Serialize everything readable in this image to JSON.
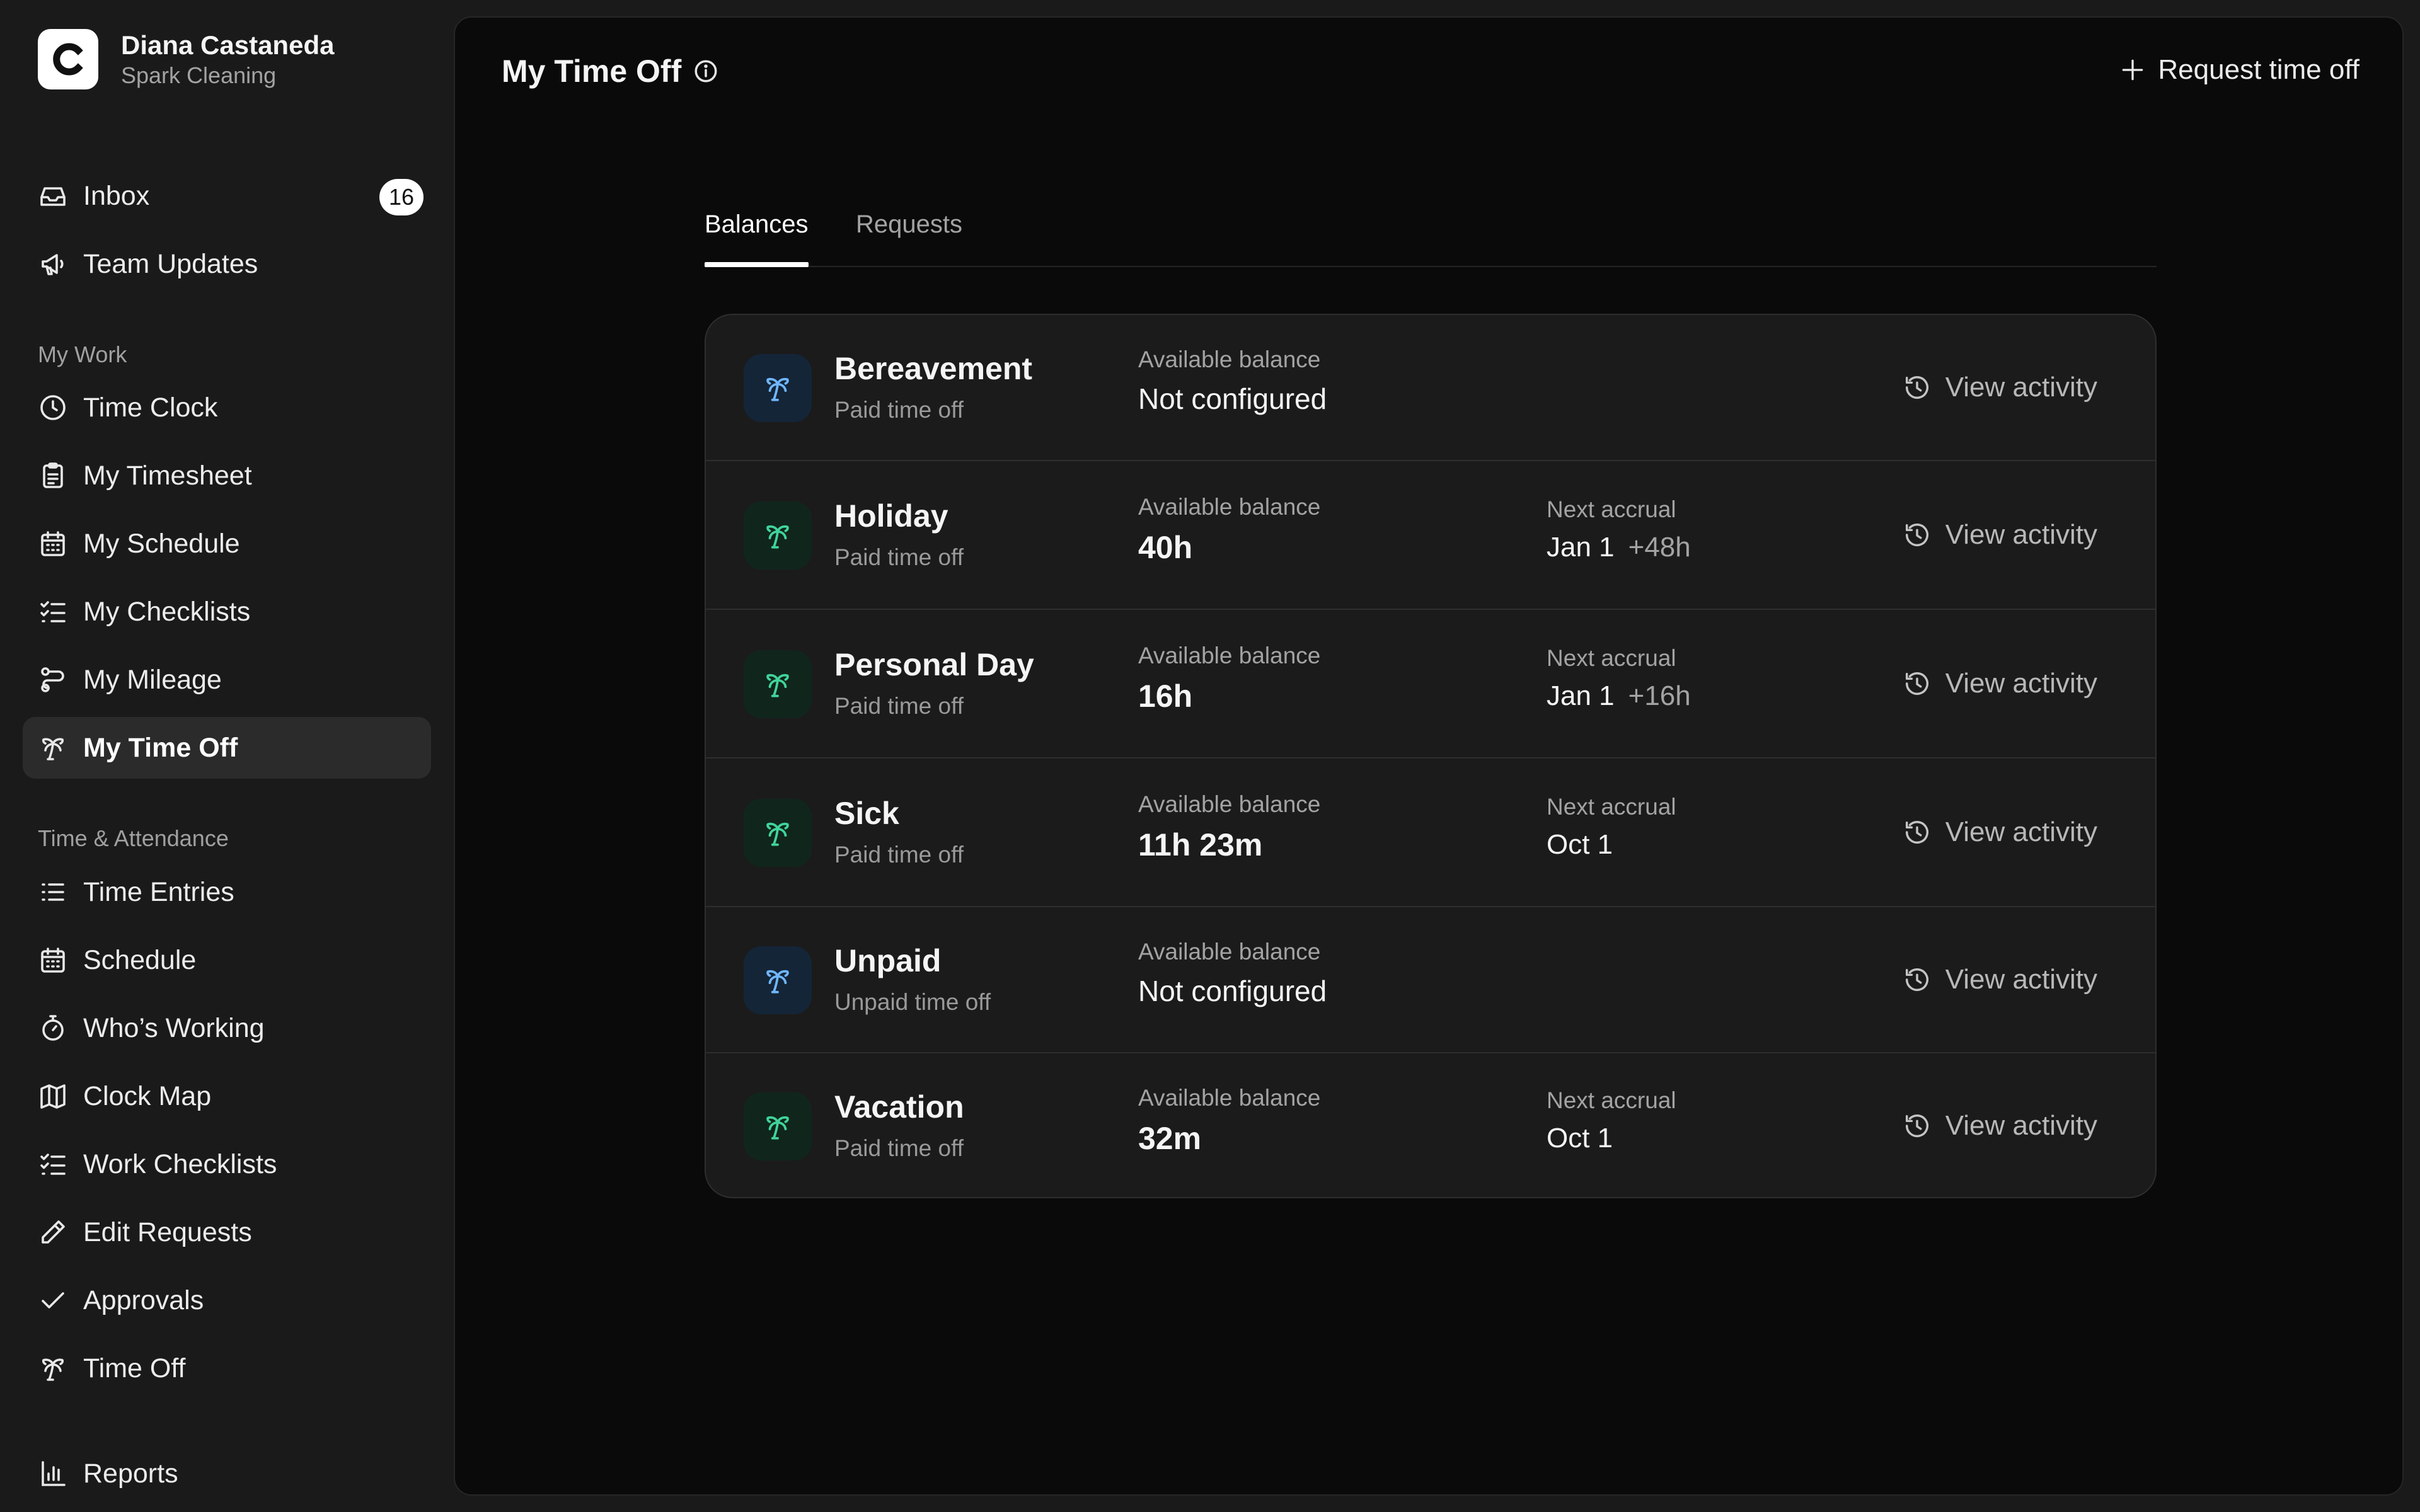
{
  "account": {
    "name": "Diana Castaneda",
    "org": "Spark Cleaning",
    "logo_letter": "C"
  },
  "nav": {
    "top": [
      {
        "id": "inbox",
        "label": "Inbox",
        "icon": "inbox-icon",
        "badge": "16"
      },
      {
        "id": "team-updates",
        "label": "Team Updates",
        "icon": "megaphone-icon"
      }
    ],
    "my_work_label": "My Work",
    "my_work": [
      {
        "id": "time-clock",
        "label": "Time Clock",
        "icon": "clock-icon"
      },
      {
        "id": "my-timesheet",
        "label": "My Timesheet",
        "icon": "clipboard-icon"
      },
      {
        "id": "my-schedule",
        "label": "My Schedule",
        "icon": "calendar-icon"
      },
      {
        "id": "my-checklists",
        "label": "My Checklists",
        "icon": "checklist-icon"
      },
      {
        "id": "my-mileage",
        "label": "My Mileage",
        "icon": "route-icon"
      },
      {
        "id": "my-time-off",
        "label": "My Time Off",
        "icon": "palm-tree-icon",
        "active": true
      }
    ],
    "attendance_label": "Time & Attendance",
    "attendance": [
      {
        "id": "time-entries",
        "label": "Time Entries",
        "icon": "list-icon"
      },
      {
        "id": "schedule",
        "label": "Schedule",
        "icon": "calendar-icon"
      },
      {
        "id": "whos-working",
        "label": "Who’s Working",
        "icon": "stopwatch-icon"
      },
      {
        "id": "clock-map",
        "label": "Clock Map",
        "icon": "map-icon"
      },
      {
        "id": "work-checklists",
        "label": "Work Checklists",
        "icon": "checklist-icon"
      },
      {
        "id": "edit-requests",
        "label": "Edit Requests",
        "icon": "pencil-icon"
      },
      {
        "id": "approvals",
        "label": "Approvals",
        "icon": "check-icon"
      },
      {
        "id": "time-off",
        "label": "Time Off",
        "icon": "palm-tree-icon"
      }
    ],
    "bottom": [
      {
        "id": "reports",
        "label": "Reports",
        "icon": "bar-chart-icon"
      }
    ]
  },
  "page": {
    "title": "My Time Off",
    "request_label": "Request time off",
    "tabs": [
      {
        "label": "Balances",
        "active": true
      },
      {
        "label": "Requests",
        "active": false
      }
    ]
  },
  "balances": {
    "available_label": "Available balance",
    "accrual_label": "Next accrual",
    "view_label": "View activity",
    "rows": [
      {
        "name": "Bereavement",
        "sub": "Paid time off",
        "balance": "Not configured",
        "tone": "blue"
      },
      {
        "name": "Holiday",
        "sub": "Paid time off",
        "balance": "40h",
        "accrual_date": "Jan 1",
        "accrual_amount": "+48h",
        "tone": "green"
      },
      {
        "name": "Personal Day",
        "sub": "Paid time off",
        "balance": "16h",
        "accrual_date": "Jan 1",
        "accrual_amount": "+16h",
        "tone": "green"
      },
      {
        "name": "Sick",
        "sub": "Paid time off",
        "balance": "11h 23m",
        "accrual_date": "Oct 1",
        "tone": "green"
      },
      {
        "name": "Unpaid",
        "sub": "Unpaid time off",
        "balance": "Not configured",
        "tone": "blue"
      },
      {
        "name": "Vacation",
        "sub": "Paid time off",
        "balance": "32m",
        "accrual_date": "Oct 1",
        "tone": "green"
      }
    ]
  }
}
